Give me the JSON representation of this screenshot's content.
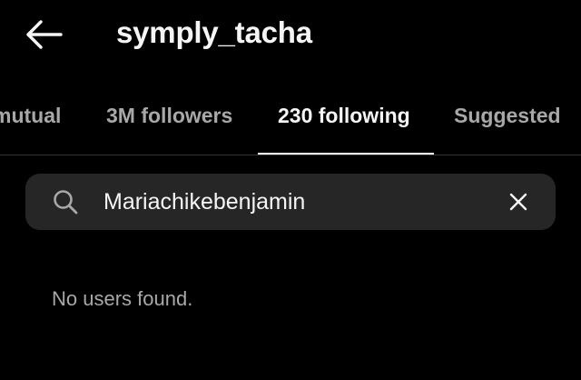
{
  "header": {
    "title": "symply_tacha",
    "back_icon": "arrow-left-icon"
  },
  "tabs": [
    {
      "label": "mutual",
      "active": false
    },
    {
      "label": "3M followers",
      "active": false
    },
    {
      "label": "230 following",
      "active": true
    },
    {
      "label": "Suggested",
      "active": false
    }
  ],
  "search": {
    "value": "Mariachikebenjamin",
    "icon": "search-icon",
    "clear_icon": "close-icon"
  },
  "results": {
    "empty_message": "No users found."
  },
  "colors": {
    "background": "#000000",
    "primary_text": "#f5f5f5",
    "secondary_text": "#a8a8a8",
    "search_background": "#262626",
    "divider": "#363636"
  }
}
